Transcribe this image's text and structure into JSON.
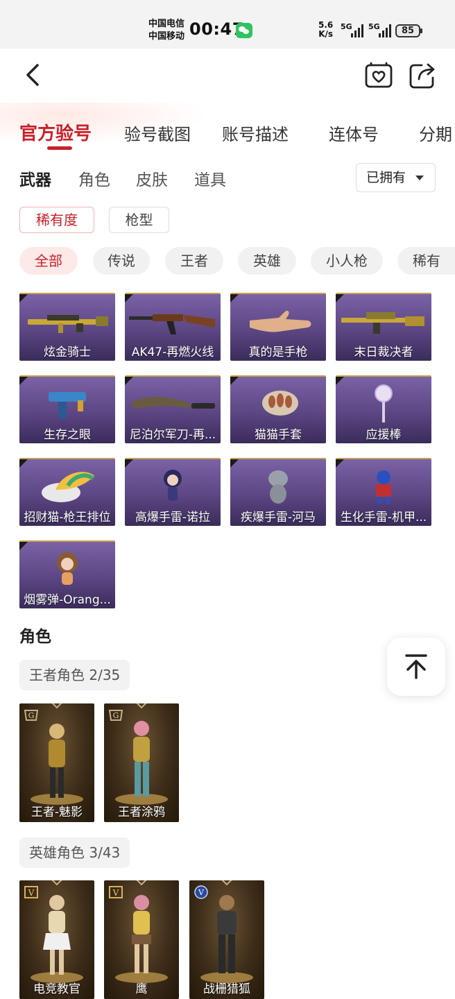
{
  "status_bar": {
    "carrier_1": "中国电信",
    "carrier_2": "中国移动",
    "time": "00:47",
    "net_speed_value": "5.6",
    "net_speed_unit": "K/s",
    "signal_1": "5G",
    "signal_2": "5G",
    "battery": "85"
  },
  "header": {
    "back_icon": "chevron-left-icon",
    "favorite_icon": "heart-icon",
    "share_icon": "share-icon"
  },
  "tabs": [
    "官方验号",
    "验号截图",
    "账号描述",
    "连体号",
    "分期"
  ],
  "active_tab": 0,
  "categories": [
    "武器",
    "角色",
    "皮肤",
    "道具"
  ],
  "active_category": 0,
  "owned_filter": "已拥有",
  "sort_buttons": [
    "稀有度",
    "枪型"
  ],
  "rarity_chips": [
    "全部",
    "传说",
    "王者",
    "英雄",
    "小人枪",
    "稀有"
  ],
  "weapons": [
    {
      "name": "炫金骑士",
      "art": "gold-rifle"
    },
    {
      "name": "AK47-再燃火线",
      "art": "ak47"
    },
    {
      "name": "真的是手枪",
      "art": "hand"
    },
    {
      "name": "末日裁决者",
      "art": "gold-mg"
    },
    {
      "name": "生存之眼",
      "art": "smg"
    },
    {
      "name": "尼泊尔军刀-再...",
      "art": "kukri"
    },
    {
      "name": "猫猫手套",
      "art": "paw"
    },
    {
      "name": "应援棒",
      "art": "glowstick"
    },
    {
      "name": "招财猫-枪王排位",
      "art": "cat-paw"
    },
    {
      "name": "高爆手雷-诺拉",
      "art": "chibi-girl"
    },
    {
      "name": "疾爆手雷-河马",
      "art": "hippo"
    },
    {
      "name": "生化手雷-机甲...",
      "art": "robot"
    },
    {
      "name": "烟雾弹-Orang...",
      "art": "chibi-orange"
    }
  ],
  "roles_section": {
    "title": "角色",
    "king_group": "王者角色 2/35",
    "king_roles": [
      {
        "name": "王者-魅影",
        "badge": "G"
      },
      {
        "name": "王者涂鸦",
        "badge": "G"
      }
    ],
    "hero_group": "英雄角色 3/43",
    "hero_roles": [
      {
        "name": "电竞教官",
        "badge": "V"
      },
      {
        "name": "鹰",
        "badge": "V"
      },
      {
        "name": "战栅猎狐",
        "badge": "V"
      }
    ]
  },
  "scroll_top_icon": "arrow-up-to-top-icon",
  "colors": {
    "accent": "#c8202a",
    "weapon_card": "#5c4683",
    "role_card": "#3d2c19"
  }
}
